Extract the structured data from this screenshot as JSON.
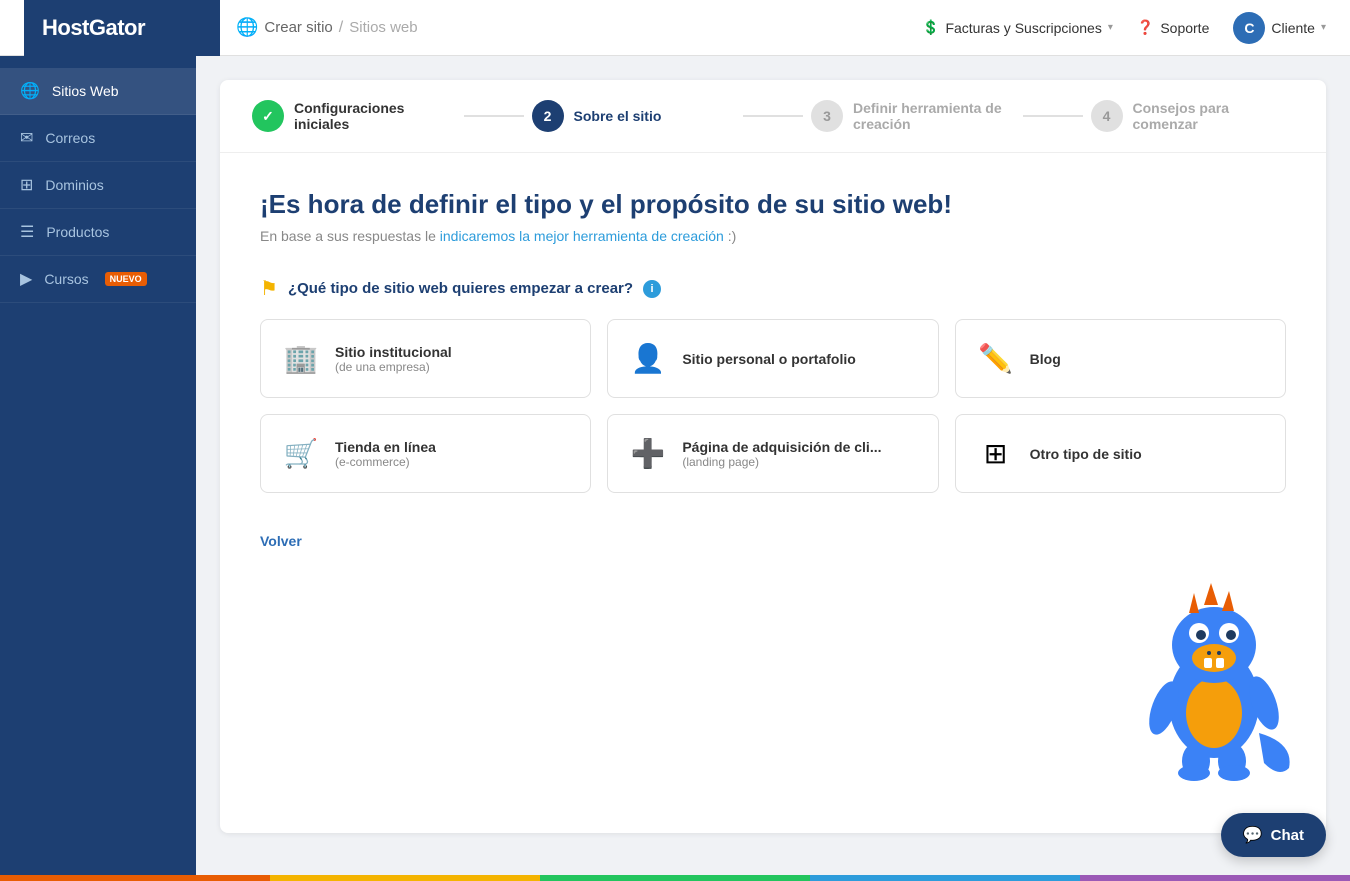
{
  "header": {
    "logo": "HostGator",
    "breadcrumb_link": "Crear sitio",
    "breadcrumb_sep": "/",
    "breadcrumb_current": "Sitios web",
    "facturas_label": "Facturas y Suscripciones",
    "soporte_label": "Soporte",
    "cliente_label": "Cliente",
    "avatar_letter": "C"
  },
  "sidebar": {
    "items": [
      {
        "label": "Sitios Web",
        "icon": "🌐",
        "active": true
      },
      {
        "label": "Correos",
        "icon": "✉",
        "active": false
      },
      {
        "label": "Dominios",
        "icon": "▦",
        "active": false
      },
      {
        "label": "Productos",
        "icon": "☰",
        "active": false
      },
      {
        "label": "Cursos",
        "icon": "▶",
        "active": false,
        "badge": "NUEVO"
      }
    ]
  },
  "stepper": {
    "steps": [
      {
        "number": "✓",
        "label": "Configuraciones iniciales",
        "state": "done"
      },
      {
        "number": "2",
        "label": "Sobre el sitio",
        "state": "active"
      },
      {
        "number": "3",
        "label": "Definir herramienta de creación",
        "state": "inactive"
      },
      {
        "number": "4",
        "label": "Consejos para comenzar",
        "state": "inactive"
      }
    ]
  },
  "main": {
    "title": "¡Es hora de definir el tipo y el propósito de su sitio web!",
    "subtitle": "En base a sus respuestas le indicaremos la mejor herramienta de creación :)",
    "question": "¿Qué tipo de sitio web quieres empezar a crear?",
    "options": [
      {
        "icon": "🏢",
        "title": "Sitio institucional",
        "sub": "(de una empresa)"
      },
      {
        "icon": "👤",
        "title": "Sitio personal o portafolio",
        "sub": ""
      },
      {
        "icon": "✏️",
        "title": "Blog",
        "sub": ""
      },
      {
        "icon": "🛒",
        "title": "Tienda en línea",
        "sub": "(e-commerce)"
      },
      {
        "icon": "➕",
        "title": "Página de adquisición de cli...",
        "sub": "(landing page)"
      },
      {
        "icon": "🔲",
        "title": "Otro tipo de sitio",
        "sub": ""
      }
    ],
    "back_label": "Volver",
    "chat_label": "Chat"
  }
}
